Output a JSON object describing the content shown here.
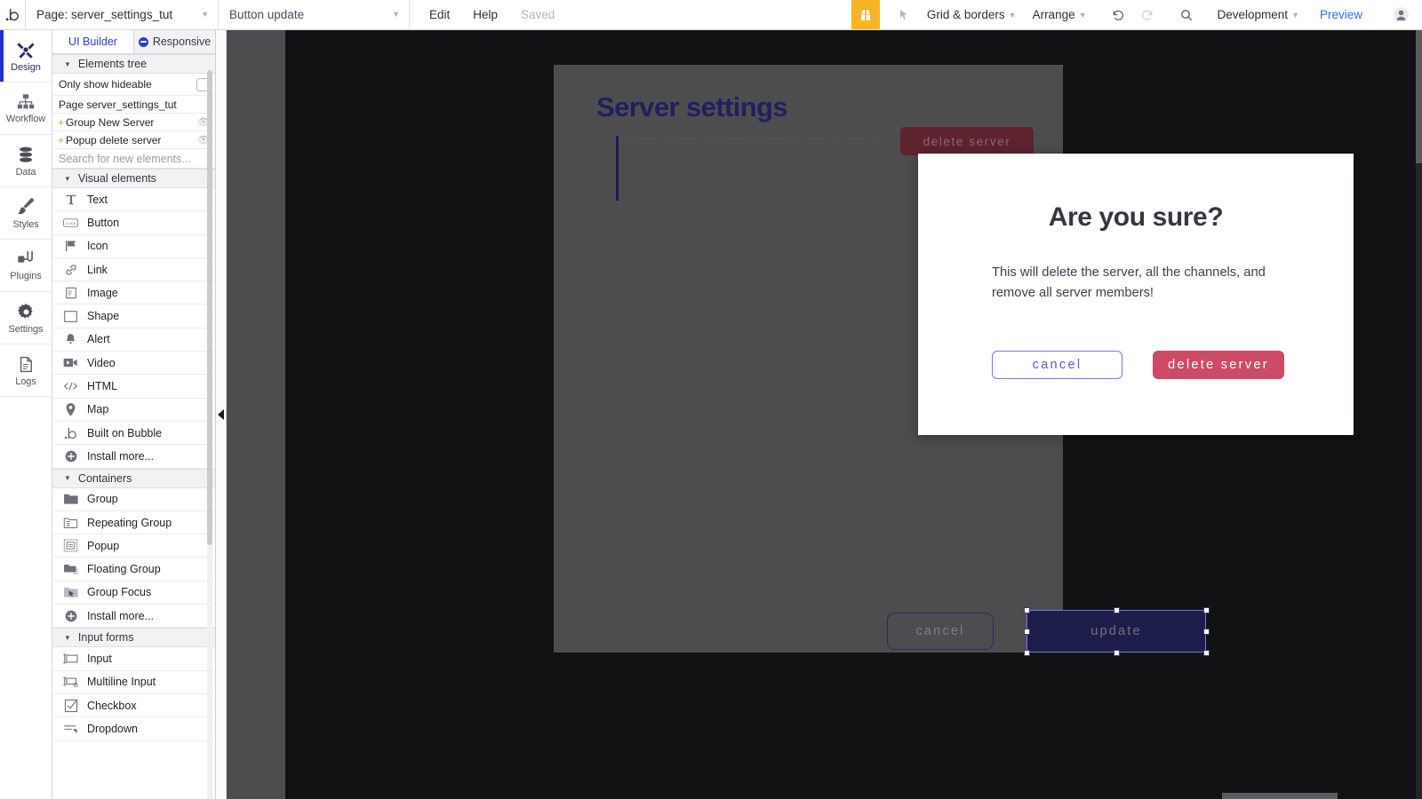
{
  "topbar": {
    "logo_icon": "bubble-logo-icon",
    "page_selector": {
      "label": "Page: server_settings_tut",
      "caret": "▼"
    },
    "element_selector": {
      "label": "Button update",
      "caret": "▼"
    },
    "menu": {
      "edit": "Edit",
      "help": "Help",
      "saved": "Saved"
    },
    "gift_icon": "gift-icon",
    "cursor_icon": "cursor-arrow-icon",
    "grid_borders": {
      "label": "Grid & borders",
      "caret": "▼"
    },
    "arrange": {
      "label": "Arrange",
      "caret": "▼"
    },
    "undo_icon": "undo-icon",
    "redo_icon": "redo-icon",
    "search_icon": "search-icon",
    "version": {
      "label": "Development",
      "caret": "▼"
    },
    "preview": "Preview",
    "avatar_icon": "user-avatar-icon"
  },
  "rail": {
    "items": [
      {
        "label": "Design",
        "icon": "design-icon",
        "active": true
      },
      {
        "label": "Workflow",
        "icon": "workflow-icon",
        "active": false
      },
      {
        "label": "Data",
        "icon": "database-icon",
        "active": false
      },
      {
        "label": "Styles",
        "icon": "brush-icon",
        "active": false
      },
      {
        "label": "Plugins",
        "icon": "plug-icon",
        "active": false
      },
      {
        "label": "Settings",
        "icon": "gear-icon",
        "active": false
      },
      {
        "label": "Logs",
        "icon": "document-icon",
        "active": false
      }
    ]
  },
  "panel": {
    "tabs": [
      {
        "label": "UI Builder",
        "active": true
      },
      {
        "label": "Responsive",
        "active": false
      }
    ],
    "elements_tree": {
      "header": "Elements tree",
      "only_show_hideable": "Only show hideable",
      "rows": [
        {
          "label": "Page server_settings_tut",
          "expandable": false,
          "eye": false
        },
        {
          "label": "Group New Server",
          "expandable": true,
          "eye": true
        },
        {
          "label": "Popup delete server",
          "expandable": true,
          "eye": true
        }
      ]
    },
    "search_placeholder": "Search for new elements...",
    "sections": [
      {
        "title": "Visual elements",
        "items": [
          {
            "label": "Text",
            "icon": "text-icon"
          },
          {
            "label": "Button",
            "icon": "button-icon"
          },
          {
            "label": "Icon",
            "icon": "flag-icon"
          },
          {
            "label": "Link",
            "icon": "link-icon"
          },
          {
            "label": "Image",
            "icon": "image-icon"
          },
          {
            "label": "Shape",
            "icon": "shape-icon"
          },
          {
            "label": "Alert",
            "icon": "bell-icon"
          },
          {
            "label": "Video",
            "icon": "video-icon"
          },
          {
            "label": "HTML",
            "icon": "code-icon"
          },
          {
            "label": "Map",
            "icon": "map-pin-icon"
          },
          {
            "label": "Built on Bubble",
            "icon": "bubble-logo-icon"
          },
          {
            "label": "Install more...",
            "icon": "plus-circle-icon"
          }
        ]
      },
      {
        "title": "Containers",
        "items": [
          {
            "label": "Group",
            "icon": "folder-icon"
          },
          {
            "label": "Repeating Group",
            "icon": "repeating-folder-icon"
          },
          {
            "label": "Popup",
            "icon": "popup-icon"
          },
          {
            "label": "Floating Group",
            "icon": "floating-group-icon"
          },
          {
            "label": "Group Focus",
            "icon": "group-focus-icon"
          },
          {
            "label": "Install more...",
            "icon": "plus-circle-icon"
          }
        ]
      },
      {
        "title": "Input forms",
        "items": [
          {
            "label": "Input",
            "icon": "input-icon"
          },
          {
            "label": "Multiline Input",
            "icon": "multiline-input-icon"
          },
          {
            "label": "Checkbox",
            "icon": "checkbox-icon"
          },
          {
            "label": "Dropdown",
            "icon": "dropdown-icon"
          }
        ]
      }
    ],
    "collapse_icon": "collapse-left-icon"
  },
  "canvas": {
    "page": {
      "title": "Server settings",
      "delete_server_button": "delete server",
      "cancel_button": "cancel",
      "update_button": "update"
    },
    "popup": {
      "title": "Are you sure?",
      "body": "This will delete the server, all the channels, and remove all server members!",
      "cancel_button": "cancel",
      "delete_button": "delete server"
    }
  },
  "colors": {
    "accent_blue": "#2d3fc9",
    "gift_yellow": "#f8b425",
    "canvas_black": "#111214",
    "page_gray": "#4d4d50",
    "title_navy": "#20205e",
    "danger_red": "#cd4b66",
    "update_navy": "#1d1d4c"
  }
}
